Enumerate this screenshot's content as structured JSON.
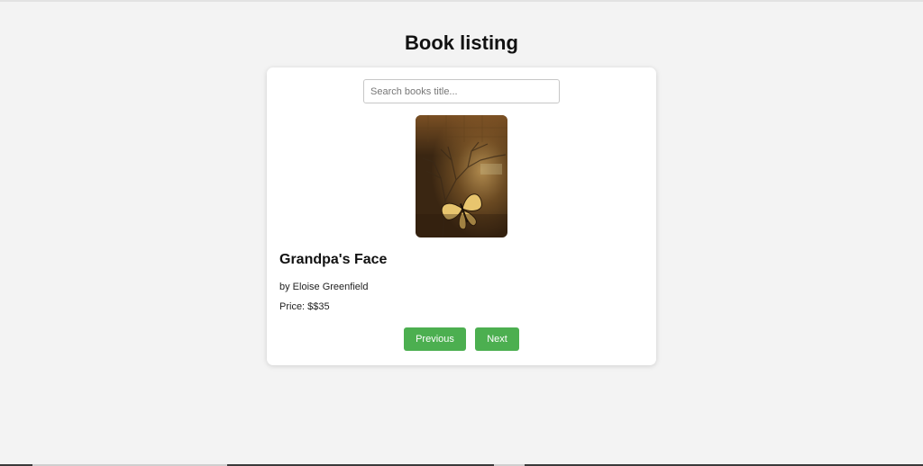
{
  "page": {
    "title": "Book listing"
  },
  "search": {
    "placeholder": "Search books title...",
    "value": ""
  },
  "book": {
    "title": "Grandpa's Face",
    "author": "by Eloise Greenfield",
    "price": "Price: $$35",
    "cover_icon": "book-cover-image"
  },
  "pagination": {
    "previous_label": "Previous",
    "next_label": "Next"
  },
  "colors": {
    "accent": "#4caf50",
    "background": "#f3f3f3",
    "card": "#ffffff"
  }
}
